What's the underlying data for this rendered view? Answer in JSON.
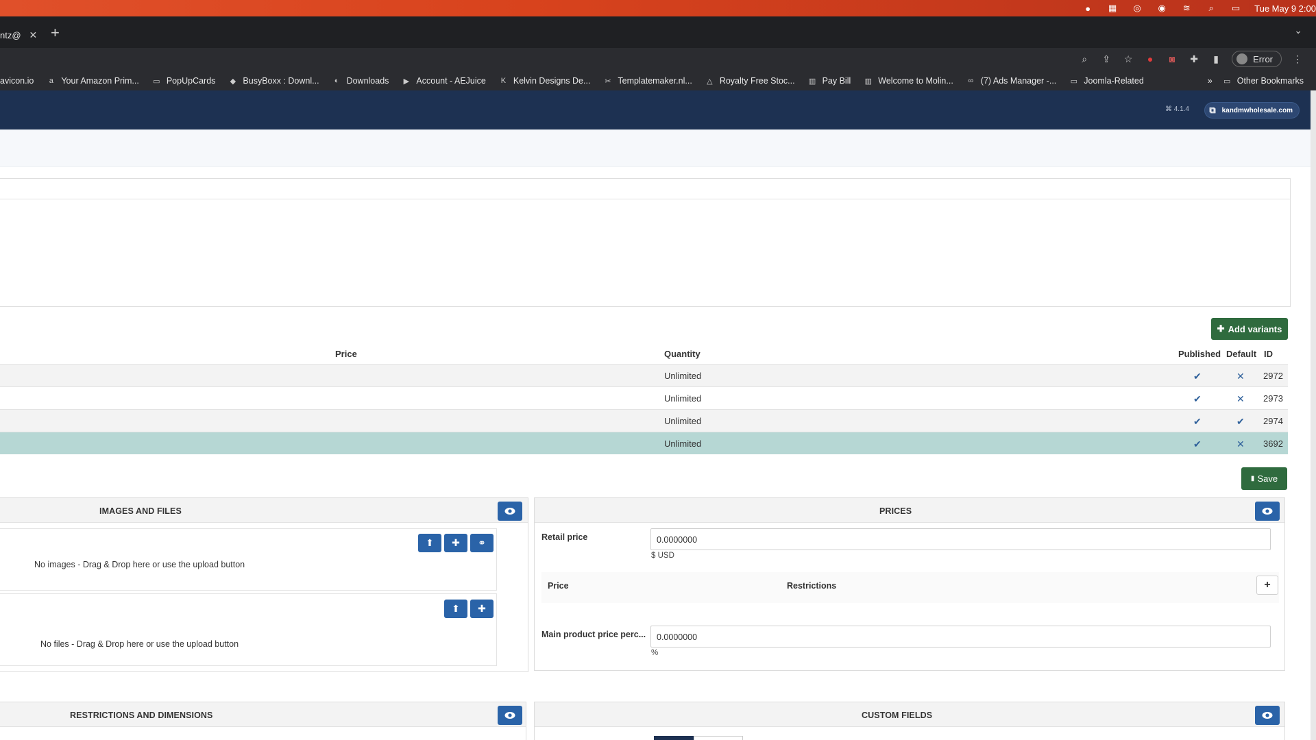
{
  "menubar": {
    "clock": "Tue May 9  2:00"
  },
  "tabs": {
    "active_title": "ntz@",
    "close_glyph": "✕",
    "new_tab_glyph": "+"
  },
  "toolbar": {
    "error_label": "Error"
  },
  "bookmarks": {
    "items": [
      {
        "label": "avicon.io",
        "icon": "none"
      },
      {
        "label": "Your Amazon Prim...",
        "icon": "amazon-icon"
      },
      {
        "label": "PopUpCards",
        "icon": "folder-icon"
      },
      {
        "label": "BusyBoxx : Downl...",
        "icon": "busyboxx-icon"
      },
      {
        "label": "Downloads",
        "icon": "downloads-icon"
      },
      {
        "label": "Account - AEJuice",
        "icon": "aejuice-icon"
      },
      {
        "label": "Kelvin Designs De...",
        "icon": "k-icon"
      },
      {
        "label": "Templatemaker.nl...",
        "icon": "scissors-icon"
      },
      {
        "label": "Royalty Free Stoc...",
        "icon": "triangle-icon"
      },
      {
        "label": "Pay Bill",
        "icon": "building-icon"
      },
      {
        "label": "Welcome to Molin...",
        "icon": "building-icon"
      },
      {
        "label": "(7) Ads Manager -...",
        "icon": "meta-icon"
      },
      {
        "label": "Joomla-Related",
        "icon": "folder-icon"
      }
    ],
    "overflow_glyph": "»",
    "other_label": "Other Bookmarks"
  },
  "admin": {
    "version": "⌘ 4.1.4",
    "site_link": "kandmwholesale.com"
  },
  "variants": {
    "add_label": "Add variants",
    "headers": {
      "price": "Price",
      "quantity": "Quantity",
      "published": "Published",
      "default": "Default",
      "id": "ID"
    },
    "rows": [
      {
        "quantity": "Unlimited",
        "published": "✔",
        "default": "✕",
        "id": "2972"
      },
      {
        "quantity": "Unlimited",
        "published": "✔",
        "default": "✕",
        "id": "2973"
      },
      {
        "quantity": "Unlimited",
        "published": "✔",
        "default": "✔",
        "id": "2974"
      },
      {
        "quantity": "Unlimited",
        "published": "✔",
        "default": "✕",
        "id": "3692"
      }
    ],
    "save_label": "Save"
  },
  "images_panel": {
    "title": "IMAGES AND FILES",
    "no_images": "No images - Drag & Drop here or use the upload button",
    "no_files": "No files - Drag & Drop here or use the upload button"
  },
  "prices_panel": {
    "title": "PRICES",
    "retail_label": "Retail price",
    "retail_value": "0.0000000",
    "retail_currency": "$ USD",
    "price_col": "Price",
    "restrictions_col": "Restrictions",
    "main_pct_label": "Main product price perc...",
    "main_pct_value": "0.0000000",
    "main_pct_unit": "%"
  },
  "restrictions_panel": {
    "title": "RESTRICTIONS AND DIMENSIONS"
  },
  "custom_fields_panel": {
    "title": "CUSTOM FIELDS"
  },
  "colors": {
    "admin_header": "#1d3152",
    "green_button": "#2f6b3e",
    "blue_button": "#2a63a8",
    "selected_row": "#b6d7d4"
  }
}
